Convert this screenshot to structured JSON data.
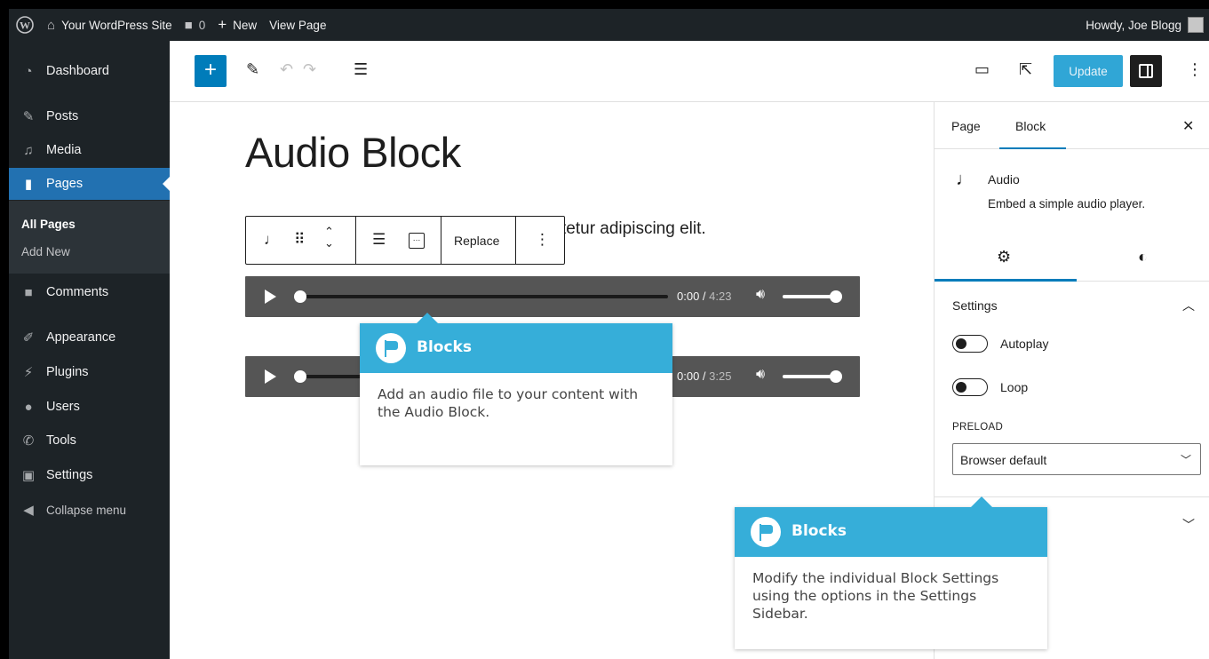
{
  "admin_bar": {
    "site_name": "Your WordPress Site",
    "comments_count": "0",
    "new_label": "New",
    "view_page_label": "View Page",
    "howdy": "Howdy, Joe Blogg"
  },
  "sidebar": {
    "items": [
      {
        "label": "Dashboard",
        "icon": "dashboard-icon"
      },
      {
        "label": "Posts",
        "icon": "pin-icon"
      },
      {
        "label": "Media",
        "icon": "media-icon"
      },
      {
        "label": "Pages",
        "icon": "pages-icon"
      },
      {
        "label": "Comments",
        "icon": "comment-icon"
      },
      {
        "label": "Appearance",
        "icon": "brush-icon"
      },
      {
        "label": "Plugins",
        "icon": "plug-icon"
      },
      {
        "label": "Users",
        "icon": "users-icon"
      },
      {
        "label": "Tools",
        "icon": "wrench-icon"
      },
      {
        "label": "Settings",
        "icon": "settings-icon"
      }
    ],
    "submenu": [
      "All Pages",
      "Add New"
    ],
    "collapse_label": "Collapse menu"
  },
  "editor_header": {
    "update_label": "Update"
  },
  "canvas": {
    "title": "Audio Block",
    "paragraph_fragment": "tetur adipiscing elit.",
    "toolbar_replace_label": "Replace",
    "players": [
      {
        "current": "0:00",
        "duration": "4:23"
      },
      {
        "current": "0:00",
        "duration": "3:25"
      }
    ]
  },
  "settings_sidebar": {
    "tabs": [
      "Page",
      "Block"
    ],
    "block_name": "Audio",
    "block_description": "Embed a simple audio player.",
    "panel_title": "Settings",
    "autoplay_label": "Autoplay",
    "loop_label": "Loop",
    "preload_label": "PRELOAD",
    "preload_value": "Browser default"
  },
  "tooltips": [
    {
      "title": "Blocks",
      "body": "Add an audio file to your content with the Audio Block."
    },
    {
      "title": "Blocks",
      "body": "Modify the individual Block Settings using the options in the Settings Sidebar."
    }
  ],
  "colors": {
    "admin_dark": "#1d2327",
    "accent_blue": "#2271b1",
    "tooltip_blue": "#36aed9"
  }
}
